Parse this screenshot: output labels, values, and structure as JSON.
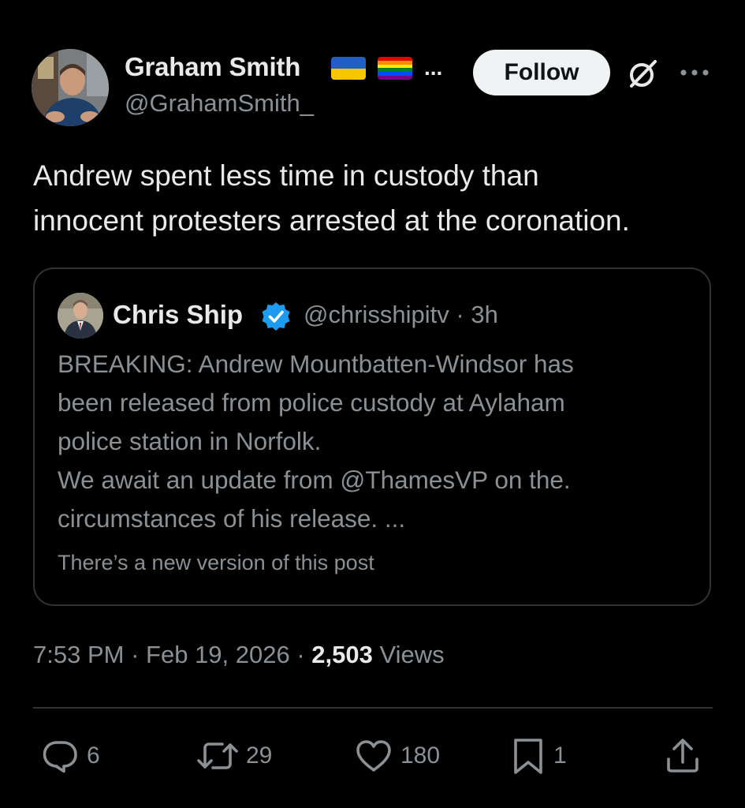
{
  "author": {
    "name": "Graham Smith",
    "name_ellipsis": "...",
    "handle": "@GrahamSmith_",
    "avatar_icon": "person-avatar-icon",
    "flags": [
      "ukraine-flag-icon",
      "rainbow-flag-icon"
    ]
  },
  "header": {
    "follow_label": "Follow",
    "grok_icon": "grok-icon",
    "more_icon": "more-options-icon"
  },
  "tweet": {
    "lines": [
      "Andrew spent less time in custody than",
      "innocent protesters arrested at the coronation."
    ]
  },
  "quote": {
    "name": "Chris Ship",
    "verified": true,
    "handle": "@chrisshipitv",
    "separator": "·",
    "time": "3h",
    "lines": [
      "BREAKING: Andrew Mountbatten-Windsor has",
      "been released from police custody at Aylaham",
      "police station in Norfolk.",
      "We await an update from @ThamesVP on the.",
      "circumstances of his release. ..."
    ],
    "version_note": "There’s a new version of this post"
  },
  "meta": {
    "time": "7:53 PM",
    "sep1": " · ",
    "date": "Feb 19, 2026",
    "sep2": " · ",
    "views_count": "2,503",
    "views_label": " Views"
  },
  "actions": {
    "replies": "6",
    "reposts": "29",
    "likes": "180",
    "bookmarks": "1"
  },
  "colors": {
    "background": "#000000",
    "primary_text": "#e7e9ea",
    "secondary_text": "#8b9095",
    "border": "#2f3336",
    "verified_blue": "#1d9bf0",
    "follow_bg": "#eff3f4"
  }
}
